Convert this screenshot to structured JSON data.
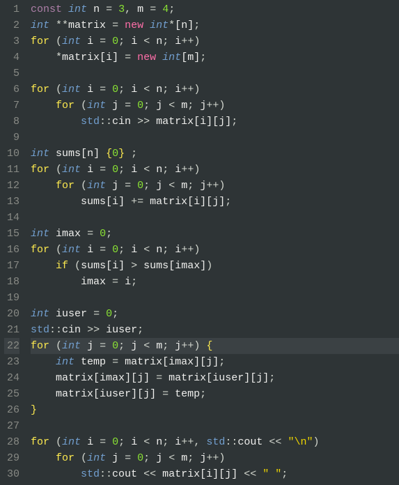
{
  "editor": {
    "current_line": 22,
    "lines": [
      {
        "n": 1,
        "html": "<span class='kw-const'>const</span> <span class='kw-type'>int</span> <span class='ident'>n</span> <span class='op'>=</span> <span class='num'>3</span><span class='punct'>,</span> <span class='ident'>m</span> <span class='op'>=</span> <span class='num'>4</span><span class='punct'>;</span>"
      },
      {
        "n": 2,
        "html": "<span class='kw-type'>int</span> <span class='op'>**</span><span class='ident'>matrix</span> <span class='op'>=</span> <span class='kw-new'>new</span> <span class='kw-type'>int</span><span class='op'>*</span><span class='brack'>[</span><span class='ident'>n</span><span class='brack'>]</span><span class='punct'>;</span>"
      },
      {
        "n": 3,
        "html": "<span class='kw-ctrl'>for</span> <span class='paren'>(</span><span class='kw-type'>int</span> <span class='ident'>i</span> <span class='op'>=</span> <span class='num'>0</span><span class='punct'>;</span> <span class='ident'>i</span> <span class='op'>&lt;</span> <span class='ident'>n</span><span class='punct'>;</span> <span class='ident'>i</span><span class='op'>++</span><span class='paren'>)</span>"
      },
      {
        "n": 4,
        "html": "    <span class='op'>*</span><span class='ident'>matrix</span><span class='brack'>[</span><span class='ident'>i</span><span class='brack'>]</span> <span class='op'>=</span> <span class='kw-new'>new</span> <span class='kw-type'>int</span><span class='brack'>[</span><span class='ident'>m</span><span class='brack'>]</span><span class='punct'>;</span>"
      },
      {
        "n": 5,
        "html": ""
      },
      {
        "n": 6,
        "html": "<span class='kw-ctrl'>for</span> <span class='paren'>(</span><span class='kw-type'>int</span> <span class='ident'>i</span> <span class='op'>=</span> <span class='num'>0</span><span class='punct'>;</span> <span class='ident'>i</span> <span class='op'>&lt;</span> <span class='ident'>n</span><span class='punct'>;</span> <span class='ident'>i</span><span class='op'>++</span><span class='paren'>)</span>"
      },
      {
        "n": 7,
        "html": "    <span class='kw-ctrl'>for</span> <span class='paren'>(</span><span class='kw-type'>int</span> <span class='ident'>j</span> <span class='op'>=</span> <span class='num'>0</span><span class='punct'>;</span> <span class='ident'>j</span> <span class='op'>&lt;</span> <span class='ident'>m</span><span class='punct'>;</span> <span class='ident'>j</span><span class='op'>++</span><span class='paren'>)</span>"
      },
      {
        "n": 8,
        "html": "        <span class='ns'>std</span><span class='punct'>::</span><span class='ident'>cin</span> <span class='op'>&gt;&gt;</span> <span class='ident'>matrix</span><span class='brack'>[</span><span class='ident'>i</span><span class='brack'>][</span><span class='ident'>j</span><span class='brack'>]</span><span class='punct'>;</span>"
      },
      {
        "n": 9,
        "html": ""
      },
      {
        "n": 10,
        "html": "<span class='kw-type'>int</span> <span class='ident'>sums</span><span class='brack'>[</span><span class='ident'>n</span><span class='brack'>]</span> <span class='brace'>{</span><span class='num'>0</span><span class='brace'>}</span> <span class='punct'>;</span>"
      },
      {
        "n": 11,
        "html": "<span class='kw-ctrl'>for</span> <span class='paren'>(</span><span class='kw-type'>int</span> <span class='ident'>i</span> <span class='op'>=</span> <span class='num'>0</span><span class='punct'>;</span> <span class='ident'>i</span> <span class='op'>&lt;</span> <span class='ident'>n</span><span class='punct'>;</span> <span class='ident'>i</span><span class='op'>++</span><span class='paren'>)</span>"
      },
      {
        "n": 12,
        "html": "    <span class='kw-ctrl'>for</span> <span class='paren'>(</span><span class='kw-type'>int</span> <span class='ident'>j</span> <span class='op'>=</span> <span class='num'>0</span><span class='punct'>;</span> <span class='ident'>j</span> <span class='op'>&lt;</span> <span class='ident'>m</span><span class='punct'>;</span> <span class='ident'>j</span><span class='op'>++</span><span class='paren'>)</span>"
      },
      {
        "n": 13,
        "html": "        <span class='ident'>sums</span><span class='brack'>[</span><span class='ident'>i</span><span class='brack'>]</span> <span class='op'>+=</span> <span class='ident'>matrix</span><span class='brack'>[</span><span class='ident'>i</span><span class='brack'>][</span><span class='ident'>j</span><span class='brack'>]</span><span class='punct'>;</span>"
      },
      {
        "n": 14,
        "html": ""
      },
      {
        "n": 15,
        "html": "<span class='kw-type'>int</span> <span class='ident'>imax</span> <span class='op'>=</span> <span class='num'>0</span><span class='punct'>;</span>"
      },
      {
        "n": 16,
        "html": "<span class='kw-ctrl'>for</span> <span class='paren'>(</span><span class='kw-type'>int</span> <span class='ident'>i</span> <span class='op'>=</span> <span class='num'>0</span><span class='punct'>;</span> <span class='ident'>i</span> <span class='op'>&lt;</span> <span class='ident'>n</span><span class='punct'>;</span> <span class='ident'>i</span><span class='op'>++</span><span class='paren'>)</span>"
      },
      {
        "n": 17,
        "html": "    <span class='kw-ctrl'>if</span> <span class='paren'>(</span><span class='ident'>sums</span><span class='brack'>[</span><span class='ident'>i</span><span class='brack'>]</span> <span class='op'>&gt;</span> <span class='ident'>sums</span><span class='brack'>[</span><span class='ident'>imax</span><span class='brack'>]</span><span class='paren'>)</span>"
      },
      {
        "n": 18,
        "html": "        <span class='ident'>imax</span> <span class='op'>=</span> <span class='ident'>i</span><span class='punct'>;</span>"
      },
      {
        "n": 19,
        "html": ""
      },
      {
        "n": 20,
        "html": "<span class='kw-type'>int</span> <span class='ident'>iuser</span> <span class='op'>=</span> <span class='num'>0</span><span class='punct'>;</span>"
      },
      {
        "n": 21,
        "html": "<span class='ns'>std</span><span class='punct'>::</span><span class='ident'>cin</span> <span class='op'>&gt;&gt;</span> <span class='ident'>iuser</span><span class='punct'>;</span>"
      },
      {
        "n": 22,
        "html": "<span class='kw-ctrl'>for</span> <span class='paren'>(</span><span class='kw-type'>int</span> <span class='ident'>j</span> <span class='op'>=</span> <span class='num'>0</span><span class='punct'>;</span> <span class='ident'>j</span> <span class='op'>&lt;</span> <span class='ident'>m</span><span class='punct'>;</span> <span class='ident'>j</span><span class='op'>++</span><span class='paren'>)</span> <span class='brace'>{</span>"
      },
      {
        "n": 23,
        "html": "    <span class='kw-type'>int</span> <span class='ident'>temp</span> <span class='op'>=</span> <span class='ident'>matrix</span><span class='brack'>[</span><span class='ident'>imax</span><span class='brack'>][</span><span class='ident'>j</span><span class='brack'>]</span><span class='punct'>;</span>"
      },
      {
        "n": 24,
        "html": "    <span class='ident'>matrix</span><span class='brack'>[</span><span class='ident'>imax</span><span class='brack'>][</span><span class='ident'>j</span><span class='brack'>]</span> <span class='op'>=</span> <span class='ident'>matrix</span><span class='brack'>[</span><span class='ident'>iuser</span><span class='brack'>][</span><span class='ident'>j</span><span class='brack'>]</span><span class='punct'>;</span>"
      },
      {
        "n": 25,
        "html": "    <span class='ident'>matrix</span><span class='brack'>[</span><span class='ident'>iuser</span><span class='brack'>][</span><span class='ident'>j</span><span class='brack'>]</span> <span class='op'>=</span> <span class='ident'>temp</span><span class='punct'>;</span>"
      },
      {
        "n": 26,
        "html": "<span class='brace'>}</span>"
      },
      {
        "n": 27,
        "html": ""
      },
      {
        "n": 28,
        "html": "<span class='kw-ctrl'>for</span> <span class='paren'>(</span><span class='kw-type'>int</span> <span class='ident'>i</span> <span class='op'>=</span> <span class='num'>0</span><span class='punct'>;</span> <span class='ident'>i</span> <span class='op'>&lt;</span> <span class='ident'>n</span><span class='punct'>;</span> <span class='ident'>i</span><span class='op'>++</span><span class='punct'>,</span> <span class='ns'>std</span><span class='punct'>::</span><span class='ident'>cout</span> <span class='op'>&lt;&lt;</span> <span class='str'>\"\\n\"</span><span class='paren'>)</span>"
      },
      {
        "n": 29,
        "html": "    <span class='kw-ctrl'>for</span> <span class='paren'>(</span><span class='kw-type'>int</span> <span class='ident'>j</span> <span class='op'>=</span> <span class='num'>0</span><span class='punct'>;</span> <span class='ident'>j</span> <span class='op'>&lt;</span> <span class='ident'>m</span><span class='punct'>;</span> <span class='ident'>j</span><span class='op'>++</span><span class='paren'>)</span>"
      },
      {
        "n": 30,
        "html": "        <span class='ns'>std</span><span class='punct'>::</span><span class='ident'>cout</span> <span class='op'>&lt;&lt;</span> <span class='ident'>matrix</span><span class='brack'>[</span><span class='ident'>i</span><span class='brack'>][</span><span class='ident'>j</span><span class='brack'>]</span> <span class='op'>&lt;&lt;</span> <span class='str'>\" \"</span><span class='punct'>;</span>"
      }
    ]
  }
}
